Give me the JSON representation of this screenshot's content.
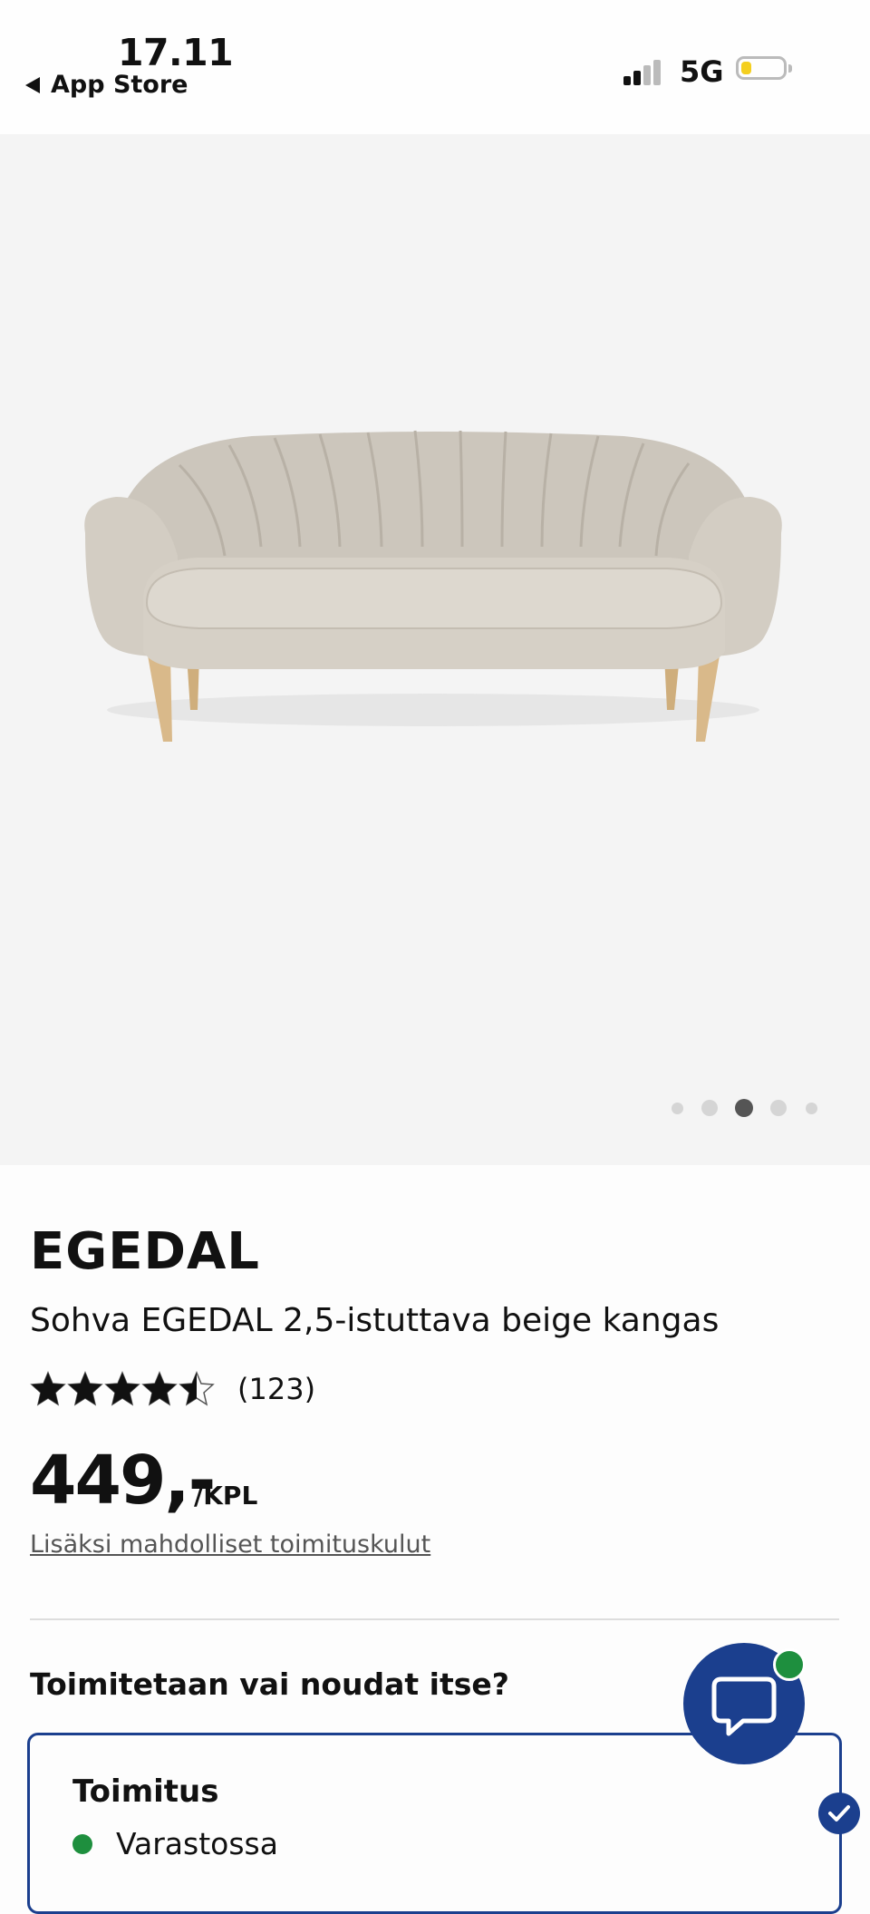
{
  "status_bar": {
    "time": "17.11",
    "back_label": "App Store",
    "network": "5G",
    "signal_bars": 2,
    "battery_level": 0.25
  },
  "carousel": {
    "image_alt": "sofa-photo",
    "dot_count": 5,
    "active_index": 2
  },
  "product": {
    "name": "EGEDAL",
    "description": "Sohva EGEDAL 2,5-istuttava beige kangas",
    "rating": 4.5,
    "rating_max": 5,
    "review_count": "(123)",
    "price": "449,-",
    "unit": "/KPL",
    "shipping_note": "Lisäksi mahdolliset toimituskulut"
  },
  "fulfillment": {
    "question": "Toimitetaan vai noudat itse?",
    "option_title": "Toimitus",
    "stock_status": "Varastossa",
    "selected": true
  },
  "colors": {
    "brand_blue": "#1b3f8e",
    "stock_green": "#1e8f3e",
    "battery_yellow": "#f4cf1f"
  },
  "icons": {
    "back": "back-arrow-icon",
    "chat": "chat-bubble-icon",
    "check": "checkmark-icon",
    "star": "star-icon"
  }
}
